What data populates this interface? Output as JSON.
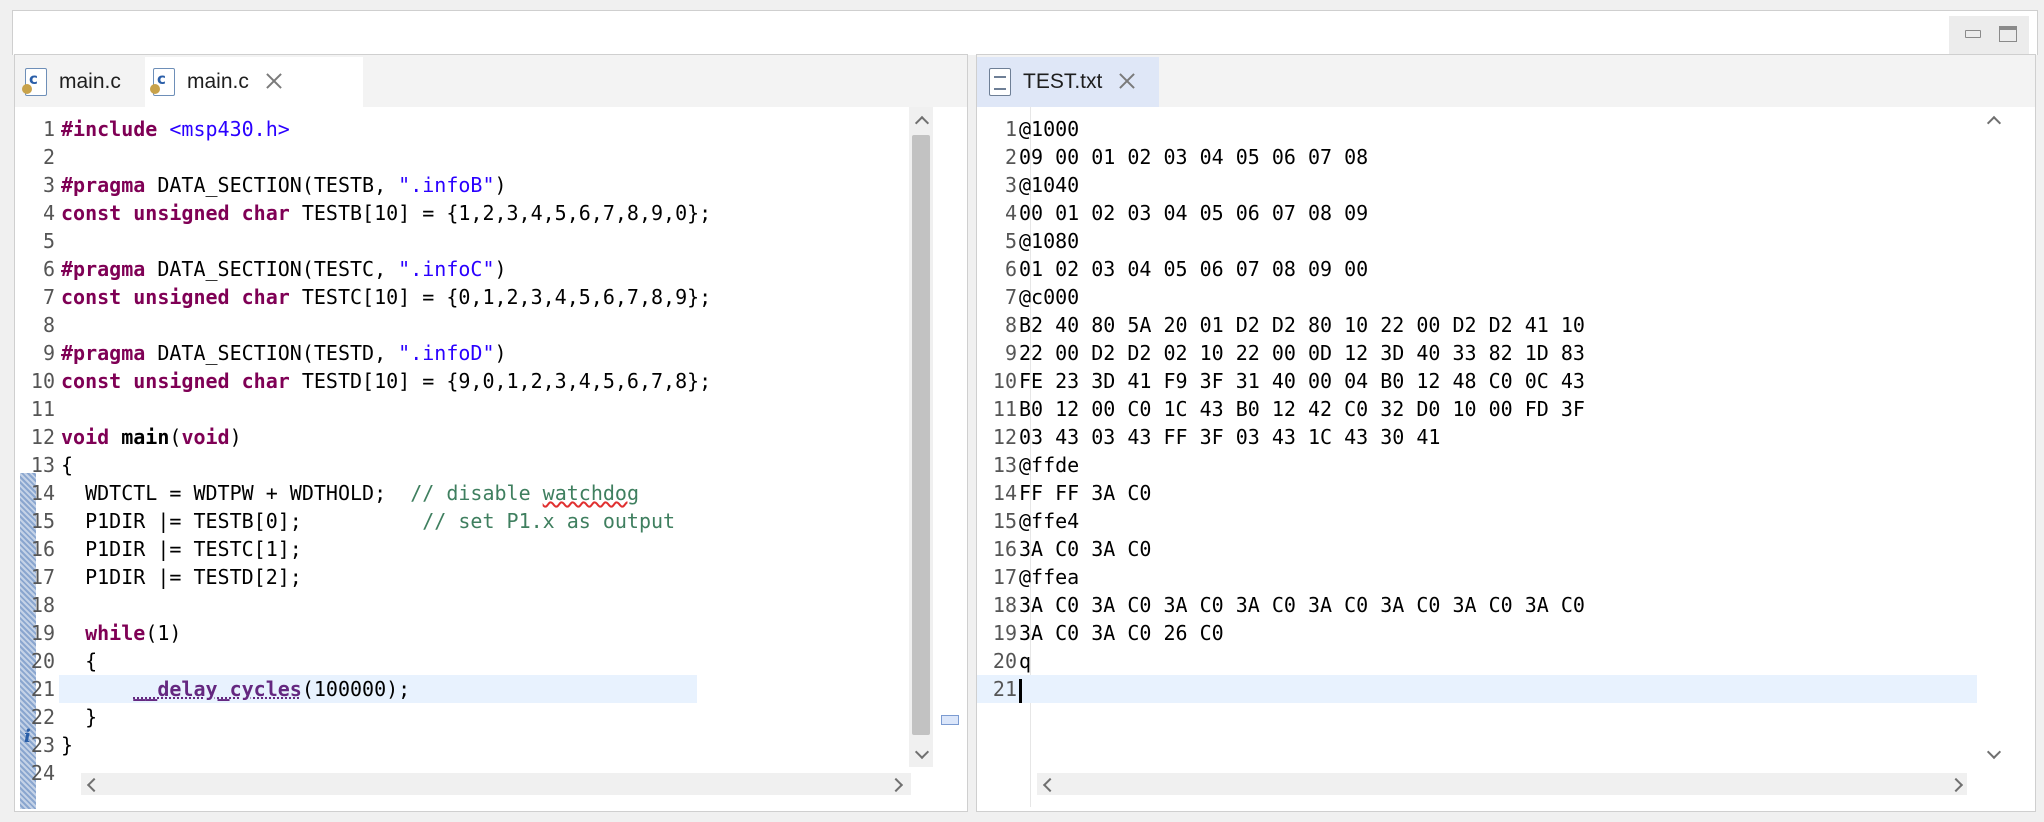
{
  "left_editor": {
    "tabs": [
      {
        "label": "main.c",
        "icon": "c-file-icon",
        "active": false
      },
      {
        "label": "main.c",
        "icon": "c-file-icon",
        "active": true,
        "closable": true
      }
    ],
    "lines": [
      {
        "n": "1",
        "code": "<span class=\"kw\">#include</span> <span class=\"str\">&lt;msp430.h&gt;</span>"
      },
      {
        "n": "2",
        "code": ""
      },
      {
        "n": "3",
        "code": "<span class=\"kw\">#pragma</span> DATA_SECTION(TESTB, <span class=\"str\">\".infoB\"</span>)"
      },
      {
        "n": "4",
        "code": "<span class=\"kw\">const unsigned char</span> TESTB[10] = {1,2,3,4,5,6,7,8,9,0};"
      },
      {
        "n": "5",
        "code": ""
      },
      {
        "n": "6",
        "code": "<span class=\"kw\">#pragma</span> DATA_SECTION(TESTC, <span class=\"str\">\".infoC\"</span>)"
      },
      {
        "n": "7",
        "code": "<span class=\"kw\">const unsigned char</span> TESTC[10] = {0,1,2,3,4,5,6,7,8,9};"
      },
      {
        "n": "8",
        "code": ""
      },
      {
        "n": "9",
        "code": "<span class=\"kw\">#pragma</span> DATA_SECTION(TESTD, <span class=\"str\">\".infoD\"</span>)"
      },
      {
        "n": "10",
        "code": "<span class=\"kw\">const unsigned char</span> TESTD[10] = {9,0,1,2,3,4,5,6,7,8};"
      },
      {
        "n": "11",
        "code": ""
      },
      {
        "n": "12",
        "code": "<span class=\"kw\">void</span> <b>main</b>(<span class=\"kw\">void</span>)"
      },
      {
        "n": "13",
        "code": "{"
      },
      {
        "n": "14",
        "code": "  WDTCTL = WDTPW + WDTHOLD;  <span class=\"cmt\">// disable <span class=\"squig\">watchdog</span></span>"
      },
      {
        "n": "15",
        "code": "  P1DIR |= TESTB[0];          <span class=\"cmt\">// set P1.x as output</span>"
      },
      {
        "n": "16",
        "code": "  P1DIR |= TESTC[1];"
      },
      {
        "n": "17",
        "code": "  P1DIR |= TESTD[2];"
      },
      {
        "n": "18",
        "code": ""
      },
      {
        "n": "19",
        "code": "  <span class=\"kw\">while</span>(1)"
      },
      {
        "n": "20",
        "code": "  {"
      },
      {
        "n": "21",
        "code": "      <span style=\"color:#642880;font-weight:bold;text-decoration:underline dotted #642880\">__delay_cycles</span>(100000);",
        "highlight": true
      },
      {
        "n": "22",
        "code": "  }"
      },
      {
        "n": "23",
        "code": "}"
      },
      {
        "n": "24",
        "code": ""
      }
    ],
    "annotation_icon": "info-icon"
  },
  "right_editor": {
    "tabs": [
      {
        "label": "TEST.txt",
        "icon": "text-file-icon",
        "active": true,
        "closable": true
      }
    ],
    "lines": [
      {
        "n": "1",
        "code": "@1000"
      },
      {
        "n": "2",
        "code": "09 00 01 02 03 04 05 06 07 08"
      },
      {
        "n": "3",
        "code": "@1040"
      },
      {
        "n": "4",
        "code": "00 01 02 03 04 05 06 07 08 09"
      },
      {
        "n": "5",
        "code": "@1080"
      },
      {
        "n": "6",
        "code": "01 02 03 04 05 06 07 08 09 00"
      },
      {
        "n": "7",
        "code": "@c000"
      },
      {
        "n": "8",
        "code": "B2 40 80 5A 20 01 D2 D2 80 10 22 00 D2 D2 41 10"
      },
      {
        "n": "9",
        "code": "22 00 D2 D2 02 10 22 00 0D 12 3D 40 33 82 1D 83"
      },
      {
        "n": "10",
        "code": "FE 23 3D 41 F9 3F 31 40 00 04 B0 12 48 C0 0C 43"
      },
      {
        "n": "11",
        "code": "B0 12 00 C0 1C 43 B0 12 42 C0 32 D0 10 00 FD 3F"
      },
      {
        "n": "12",
        "code": "03 43 03 43 FF 3F 03 43 1C 43 30 41"
      },
      {
        "n": "13",
        "code": "@ffde"
      },
      {
        "n": "14",
        "code": "FF FF 3A C0"
      },
      {
        "n": "15",
        "code": "@ffe4"
      },
      {
        "n": "16",
        "code": "3A C0 3A C0"
      },
      {
        "n": "17",
        "code": "@ffea"
      },
      {
        "n": "18",
        "code": "3A C0 3A C0 3A C0 3A C0 3A C0 3A C0 3A C0 3A C0"
      },
      {
        "n": "19",
        "code": "3A C0 3A C0 26 C0"
      },
      {
        "n": "20",
        "code": "q"
      },
      {
        "n": "21",
        "code": "",
        "highlight": true,
        "cursor": true
      }
    ]
  },
  "window_controls": {
    "minimize_icon": "minimize-icon",
    "maximize_icon": "maximize-icon"
  }
}
